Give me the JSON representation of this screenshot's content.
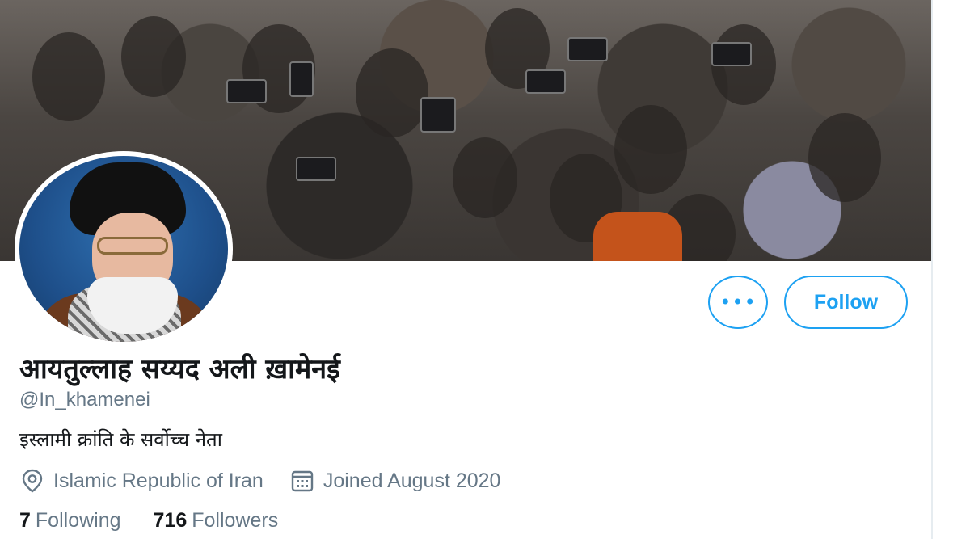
{
  "profile": {
    "display_name": "आयतुल्लाह सय्यद अली ख़ामेनई",
    "handle": "@In_khamenei",
    "bio": "इस्लामी क्रांति के सर्वोच्च नेता",
    "location": "Islamic Republic of Iran",
    "joined": "Joined August 2020",
    "location_icon": "location-pin-icon",
    "calendar_icon": "calendar-icon"
  },
  "actions": {
    "more_label": "•••",
    "follow_label": "Follow"
  },
  "stats": {
    "following_count": "7",
    "following_label": "Following",
    "followers_count": "716",
    "followers_label": "Followers"
  },
  "colors": {
    "accent": "#1da1f2",
    "text_primary": "#14171a",
    "text_secondary": "#657786"
  }
}
